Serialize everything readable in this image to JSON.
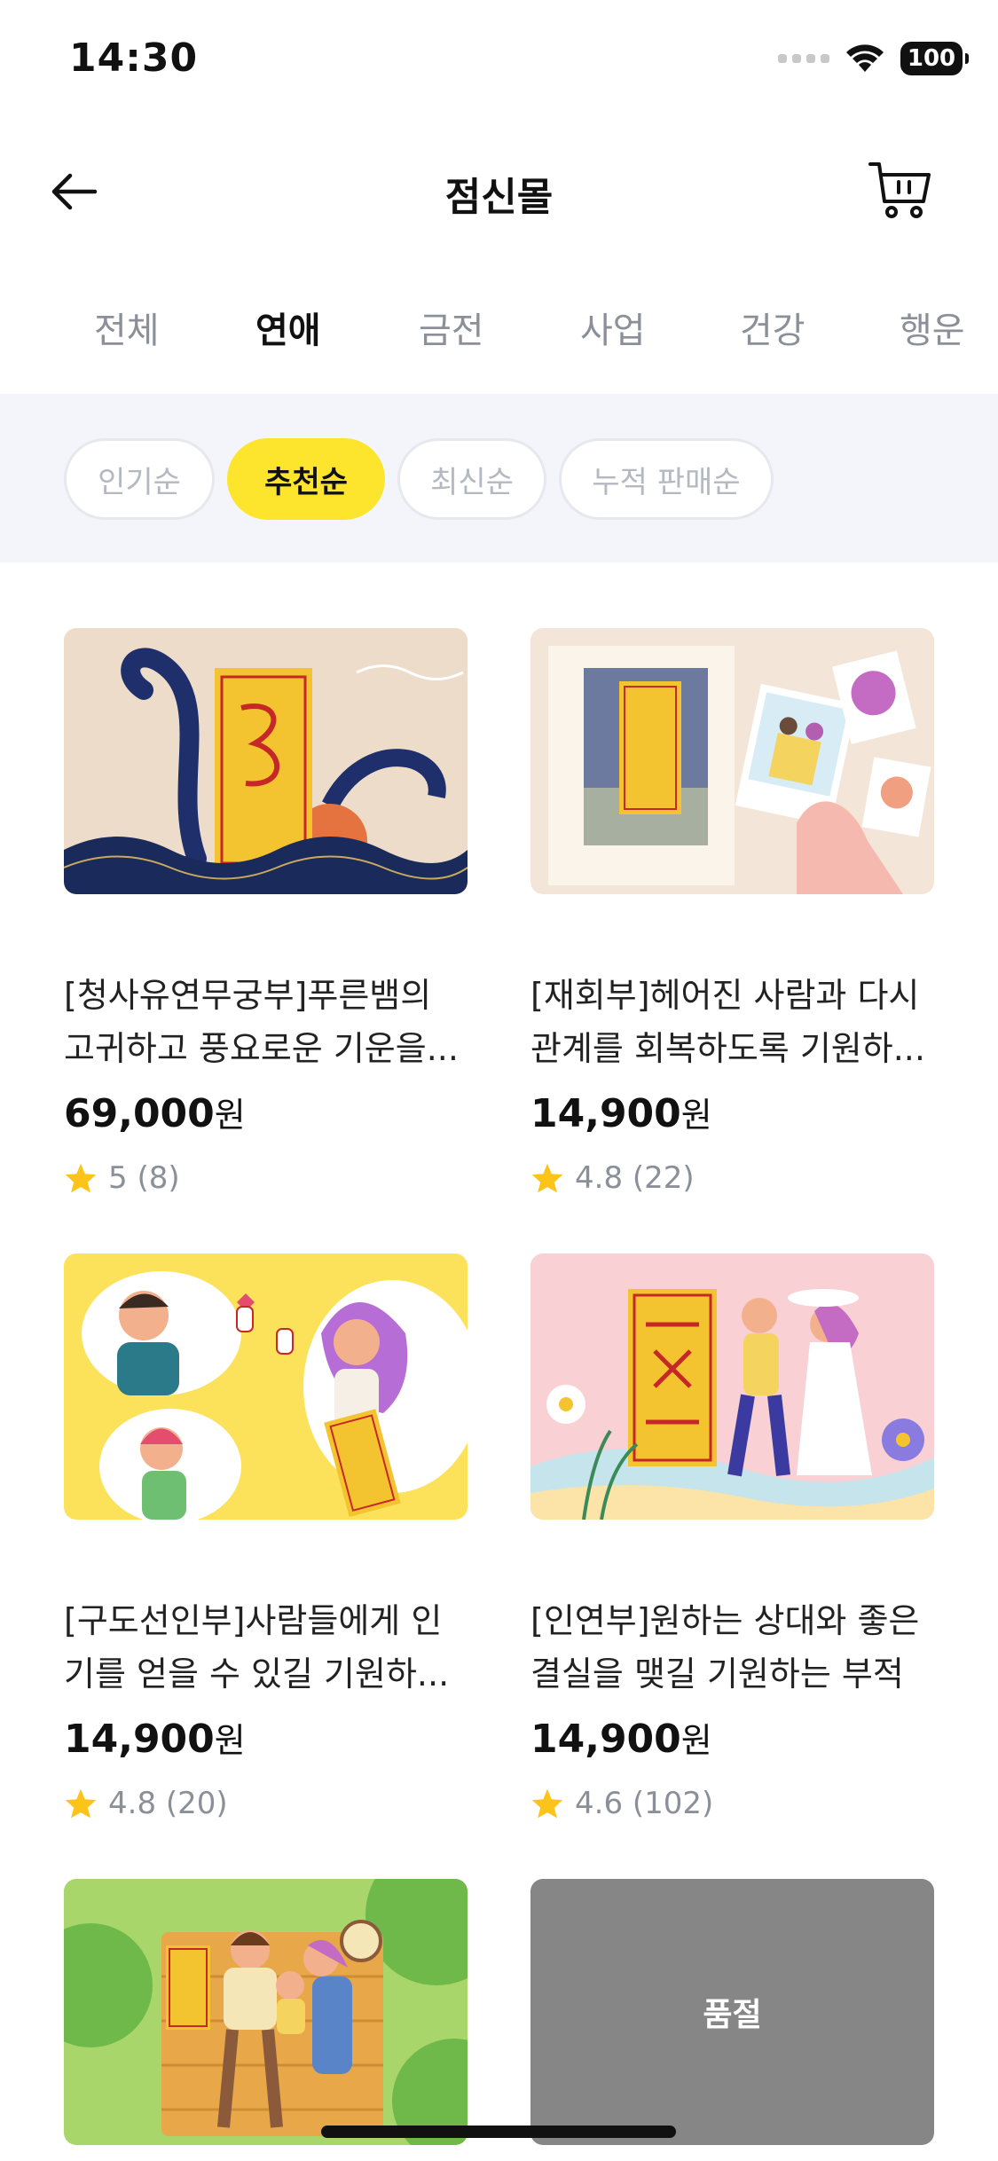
{
  "status": {
    "time": "14:30",
    "battery": "100"
  },
  "header": {
    "title": "점신몰"
  },
  "tabs": [
    {
      "label": "전체",
      "active": false
    },
    {
      "label": "연애",
      "active": true
    },
    {
      "label": "금전",
      "active": false
    },
    {
      "label": "사업",
      "active": false
    },
    {
      "label": "건강",
      "active": false
    },
    {
      "label": "행운",
      "active": false
    }
  ],
  "sort": [
    {
      "label": "인기순",
      "active": false
    },
    {
      "label": "추천순",
      "active": true
    },
    {
      "label": "최신순",
      "active": false
    },
    {
      "label": "누적 판매순",
      "active": false
    }
  ],
  "products": [
    {
      "title_line1": "[청사유연무궁부]푸른뱀의",
      "title_line2": "고귀하고 풍요로운 기운을...",
      "price": "69,000",
      "unit": "원",
      "rating": "5 (8)"
    },
    {
      "title_line1": "[재회부]헤어진 사람과 다시",
      "title_line2": "관계를 회복하도록 기원하...",
      "price": "14,900",
      "unit": "원",
      "rating": "4.8 (22)"
    },
    {
      "title_line1": "[구도선인부]사람들에게 인",
      "title_line2": "기를 얻을 수 있길 기원하...",
      "price": "14,900",
      "unit": "원",
      "rating": "4.8 (20)"
    },
    {
      "title_line1": "[인연부]원하는 상대와 좋은",
      "title_line2": "결실을 맺길 기원하는 부적",
      "price": "14,900",
      "unit": "원",
      "rating": "4.6 (102)"
    }
  ],
  "soldout_label": "품절",
  "colors": {
    "accent": "#fde52e",
    "star": "#fcc419",
    "muted": "#8a8f98",
    "sort_bg": "#f3f5fb"
  }
}
